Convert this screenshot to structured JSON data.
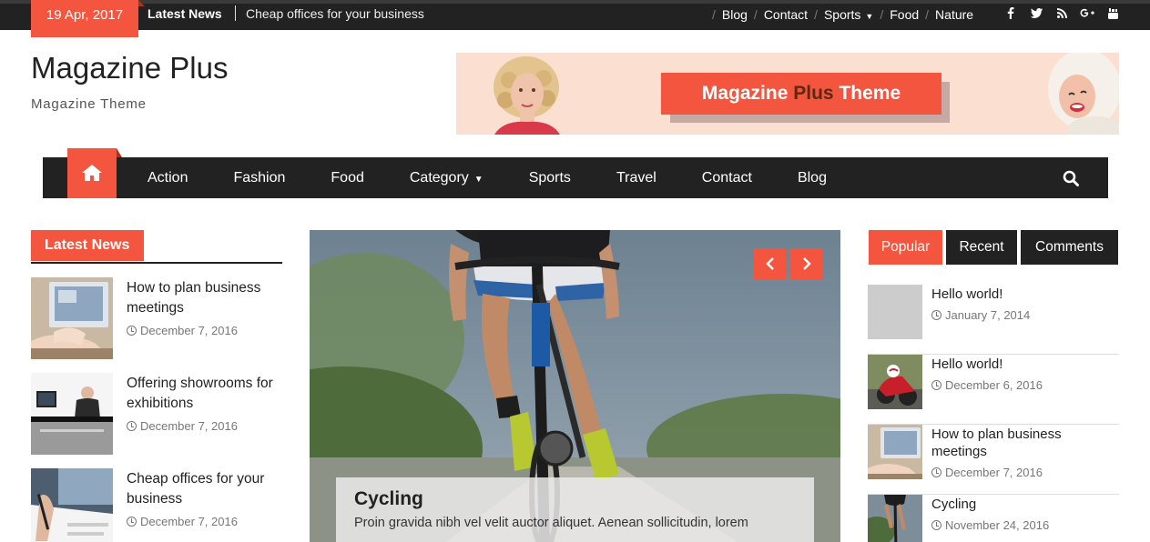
{
  "topbar": {
    "date": "19 Apr, 2017",
    "latest_label": "Latest News",
    "ticker": "Cheap offices for your business",
    "nav": [
      {
        "label": "Blog"
      },
      {
        "label": "Contact"
      },
      {
        "label": "Sports",
        "has_dropdown": true
      },
      {
        "label": "Food"
      },
      {
        "label": "Nature"
      }
    ],
    "social": [
      {
        "icon": "facebook-icon",
        "glyph": "f"
      },
      {
        "icon": "twitter-icon",
        "glyph": "t"
      },
      {
        "icon": "rss-icon",
        "glyph": "rss"
      },
      {
        "icon": "google-plus-icon",
        "glyph": "G+"
      },
      {
        "icon": "youtube-icon",
        "glyph": "yt"
      }
    ]
  },
  "header": {
    "site_title": "Magazine Plus",
    "site_description": "Magazine Theme",
    "banner": {
      "text_1": "Magazine",
      "text_2": "Plus",
      "text_3": "Theme"
    }
  },
  "mainnav": {
    "home_icon": "home-icon",
    "items": [
      {
        "label": "Action"
      },
      {
        "label": "Fashion"
      },
      {
        "label": "Food"
      },
      {
        "label": "Category",
        "has_dropdown": true
      },
      {
        "label": "Sports"
      },
      {
        "label": "Travel"
      },
      {
        "label": "Contact"
      },
      {
        "label": "Blog"
      }
    ],
    "search_icon": "search-icon"
  },
  "latest_news": {
    "heading": "Latest News",
    "items": [
      {
        "title": "How to plan business meetings",
        "date": "December 7, 2016"
      },
      {
        "title": "Offering showrooms for exhibitions",
        "date": "December 7, 2016"
      },
      {
        "title": "Cheap offices for your business",
        "date": "December 7, 2016"
      }
    ]
  },
  "slider": {
    "prev_icon": "chevron-left-icon",
    "next_icon": "chevron-right-icon",
    "title": "Cycling",
    "description": "Proin gravida nibh vel velit auctor aliquet. Aenean sollicitudin, lorem"
  },
  "sidebar": {
    "tabs": [
      "Popular",
      "Recent",
      "Comments"
    ],
    "items": [
      {
        "title": "Hello world!",
        "date": "January 7, 2014"
      },
      {
        "title": "Hello world!",
        "date": "December 6, 2016"
      },
      {
        "title": "How to plan business meetings",
        "date": "December 7, 2016"
      },
      {
        "title": "Cycling",
        "date": "November 24, 2016"
      }
    ]
  },
  "colors": {
    "accent": "#f4553e",
    "dark": "#222222"
  }
}
